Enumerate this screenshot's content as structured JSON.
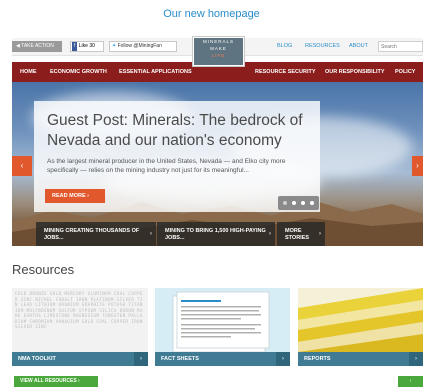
{
  "caption": "Our new homepage",
  "topbar": {
    "take_action": "TAKE ACTION",
    "fb_label": "Like",
    "fb_count": "30",
    "twitter_label": "Follow @MiningFan",
    "links": [
      "BLOG",
      "RESOURCES",
      "ABOUT"
    ],
    "search_placeholder": "Search"
  },
  "logo": {
    "line1": "MINERALS",
    "line2": "MAKE",
    "line3": "LIFE"
  },
  "nav": {
    "items": [
      "HOME",
      "ECONOMIC GROWTH",
      "ESSENTIAL APPLICATIONS",
      "RESOURCE SECURITY",
      "OUR RESPONSIBILITY",
      "POLICY"
    ]
  },
  "hero": {
    "title": "Guest Post: Minerals: The bedrock of Nevada and our nation's economy",
    "text": "As the largest mineral producer in the United States, Nevada — and Elko city more specifically — relies on the mining industry not just for its meaningful...",
    "read_more": "READ MORE ›",
    "prev_icon": "‹",
    "next_icon": "›",
    "slide_count": 4,
    "active_slide": 1
  },
  "subnav": [
    {
      "label": "MINING CREATING THOUSANDS OF JOBS..."
    },
    {
      "label": "MINING TO BRING 1,500 HIGH-PAYING JOBS..."
    },
    {
      "label": "MORE STORIES"
    }
  ],
  "resources": {
    "heading": "Resources",
    "cards": [
      {
        "label": "NMA TOOLKIT",
        "arrow": "›"
      },
      {
        "label": "FACT SHEETS",
        "arrow": "›"
      },
      {
        "label": "REPORTS",
        "arrow": "›"
      }
    ],
    "toolkit_words": "COLD BRONZE GOLD MERCURY ALUMINUM COAL COPPER ZINC NICKEL COBALT IRON PLATINUM SILVER TIN LEAD LITHIUM URANIUM GRAPHITE POTASH TITANIUM MOLYBDENUM SULFUR GYPSUM SILICA BORON RARE EARTHS LIMESTONE MAGNESIUM TUNGSTEN PALLADIUM CHROMIUM VANADIUM GOLD COAL COPPER IRON SILVER ZINC",
    "view_all": "VIEW ALL RESOURCES ›",
    "view_all_right": "›"
  }
}
